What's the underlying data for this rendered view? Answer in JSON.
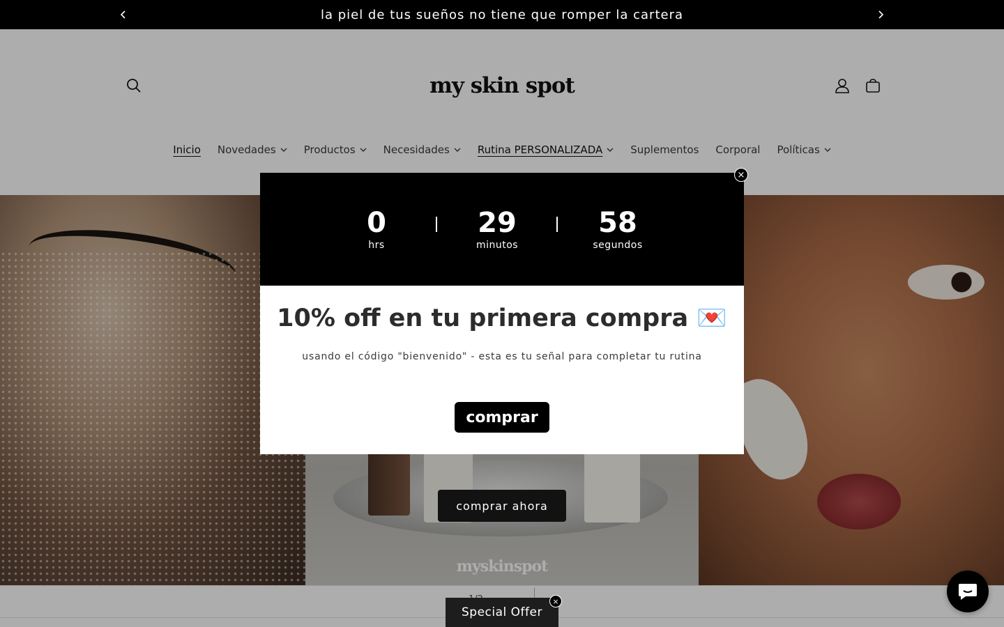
{
  "announcement": {
    "text": "la piel de tus sueños no tiene que romper la cartera",
    "prev_icon": "chevron-left-icon",
    "next_icon": "chevron-right-icon"
  },
  "header": {
    "logo": "my skin spot",
    "icons": [
      "search-icon",
      "account-icon",
      "cart-icon"
    ]
  },
  "nav": {
    "items": [
      {
        "label": "Inicio",
        "dropdown": false
      },
      {
        "label": "Novedades",
        "dropdown": true
      },
      {
        "label": "Productos",
        "dropdown": true
      },
      {
        "label": "Necesidades",
        "dropdown": true
      },
      {
        "label": "Rutina PERSONALIZADA",
        "dropdown": true
      },
      {
        "label": "Suplementos",
        "dropdown": false
      },
      {
        "label": "Corporal",
        "dropdown": false
      },
      {
        "label": "Políticas",
        "dropdown": true
      }
    ]
  },
  "hero": {
    "cta_label": "comprar ahora",
    "mid_logo": "myskinspot",
    "slide_counter": "1/2"
  },
  "popup": {
    "countdown": [
      {
        "value": "0",
        "label": "hrs"
      },
      {
        "value": "29",
        "label": "minutos"
      },
      {
        "value": "58",
        "label": "segundos"
      }
    ],
    "title": "10% off en tu primera compra 💌",
    "subtitle": "usando el código \"bienvenido\" - esta es tu señal para completar tu rutina",
    "button_label": "comprar",
    "close_symbol": "×"
  },
  "offer_tab": {
    "label": "Special Offer",
    "close_symbol": "×"
  },
  "chat": {
    "icon": "chat-icon"
  },
  "colors": {
    "announcement_bg": "#000000",
    "popup_top_bg": "#000000",
    "button_bg": "#121212"
  }
}
